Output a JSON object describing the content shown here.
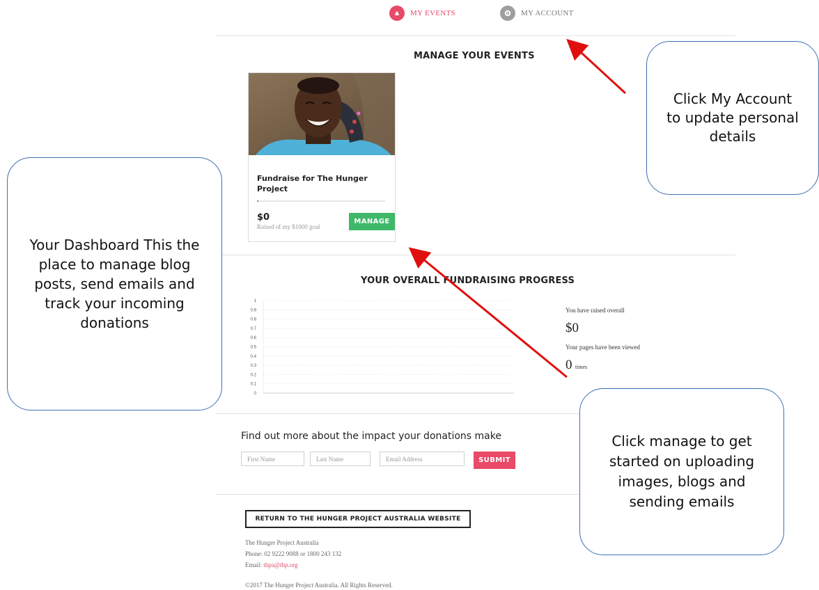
{
  "nav": {
    "items": [
      {
        "label": "MY EVENTS",
        "icon": "events-icon",
        "color": "#e84a68"
      },
      {
        "label": "MY ACCOUNT",
        "icon": "gear-icon",
        "color": "#9e9e9e"
      }
    ]
  },
  "events": {
    "title": "MANAGE YOUR EVENTS",
    "card": {
      "title": "Fundraise for The Hunger Project",
      "amount": "$0",
      "subtitle": "Raised of my $1000 goal",
      "progress": 0.0,
      "manage_label": "MANAGE",
      "image": "smiling-woman-photo"
    }
  },
  "progress": {
    "title": "YOUR OVERALL FUNDRAISING PROGRESS",
    "raised_label": "You have raised overall",
    "raised_value": "$0",
    "views_label": "Your pages have been viewed",
    "views_value": "0",
    "views_unit": "times"
  },
  "chart_data": {
    "type": "line",
    "y_ticks": [
      "1",
      "0.9",
      "0.8",
      "0.7",
      "0.6",
      "0.5",
      "0.4",
      "0.3",
      "0.2",
      "0.1",
      "0"
    ],
    "ylim": [
      0,
      1
    ],
    "grid": true,
    "series": []
  },
  "signup": {
    "title": "Find out more about the impact your donations make",
    "first_name_placeholder": "First Name",
    "last_name_placeholder": "Last Name",
    "email_placeholder": "Email Address",
    "submit_label": "SUBMIT"
  },
  "footer": {
    "return_label": "RETURN TO THE HUNGER PROJECT AUSTRALIA WEBSITE",
    "org": "The Hunger Project Australia",
    "phone": "Phone: 02 9222 9088 or 1800 243 132",
    "email_prefix": "Email: ",
    "email": "thpa@thp.org",
    "copyright": "©2017 The Hunger Project Australia. All Rights Reserved."
  },
  "callouts": {
    "dashboard": "Your Dashboard This the place to manage blog posts, send emails and track your incoming donations",
    "account": "Click My Account to update personal details",
    "manage": "Click manage to get started on uploading images, blogs and sending emails"
  },
  "colors": {
    "accent": "#e84a68",
    "manage_green": "#3fb86a",
    "callout_border": "#3f6fb3",
    "arrow": "#e01010"
  }
}
